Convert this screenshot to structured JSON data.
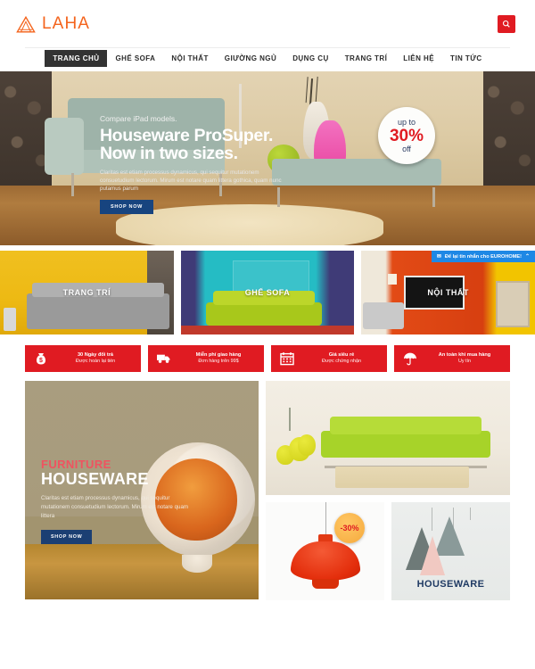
{
  "header": {
    "brand_name": "LAHA",
    "logo_icon": "triangle-house-logo",
    "logo_color": "#f4641d",
    "search_icon": "search-icon",
    "search_button_color": "#e01b22"
  },
  "nav": {
    "items": [
      {
        "label": "TRANG CHỦ",
        "active": true
      },
      {
        "label": "GHẾ SOFA",
        "active": false
      },
      {
        "label": "NỘI THẤT",
        "active": false
      },
      {
        "label": "GIƯỜNG NGỦ",
        "active": false
      },
      {
        "label": "DỤNG CỤ",
        "active": false
      },
      {
        "label": "TRANG TRÍ",
        "active": false
      },
      {
        "label": "LIÊN HỆ",
        "active": false
      },
      {
        "label": "TIN TỨC",
        "active": false
      }
    ]
  },
  "hero": {
    "kicker": "Compare iPad models.",
    "title_line1": "Houseware ProSuper.",
    "title_line2": "Now in two sizes.",
    "description": "Claritas est etiam processus dynamicus, qui sequitur mutationem consuetudium lectorum. Mirum est notare quam littera gothica, quam nunc putamus parum",
    "cta_label": "SHOP NOW",
    "cta_color": "#17447f",
    "badge": {
      "up_text": "up to",
      "percent": "30%",
      "off_text": "off",
      "percent_color": "#e01b22"
    }
  },
  "categories": [
    {
      "label": "TRANG TRÍ",
      "theme": "yellow"
    },
    {
      "label": "GHẾ SOFA",
      "theme": "teal"
    },
    {
      "label": "NỘI THẤT",
      "theme": "orange"
    }
  ],
  "chat_widget": {
    "label": "Để lại tin nhắn cho EUROHOME!",
    "envelope_icon": "envelope-icon",
    "chevron_icon": "chevron-up-icon",
    "color": "#1e88e5"
  },
  "features": {
    "strip_color": "#e01b22",
    "items": [
      {
        "icon": "money-bag-icon",
        "title": "30 Ngày đổi trả",
        "subtitle": "Được hoàn lại tiền"
      },
      {
        "icon": "delivery-truck-icon",
        "title": "Miễn phí giao hàng",
        "subtitle": "Đơn hàng trên 99$"
      },
      {
        "icon": "calendar-icon",
        "title": "Giá siêu rẻ",
        "subtitle": "Được chứng nhận"
      },
      {
        "icon": "umbrella-icon",
        "title": "An toàn khi mua hàng",
        "subtitle": "Uy tín"
      }
    ]
  },
  "showcase": {
    "promo": {
      "kicker": "FURNITURE",
      "title": "HOUSEWARE",
      "description": "Claritas est etiam processus dynamicus, qui sequitur mutationem consuetudium lectorum. Mirum est notare quam littera",
      "cta_label": "SHOP NOW",
      "kicker_color": "#ef5360",
      "cta_color": "#1b3f73"
    },
    "sofa_card": {
      "name": "green-sofa-product"
    },
    "lamp_card": {
      "name": "red-pendant-lamp-product",
      "discount_badge": "-30%",
      "badge_text_color": "#e01b22"
    },
    "houseware_card": {
      "name": "houseware-pendant-lamps",
      "label": "HOUSEWARE",
      "label_color": "#1f3a63"
    }
  }
}
